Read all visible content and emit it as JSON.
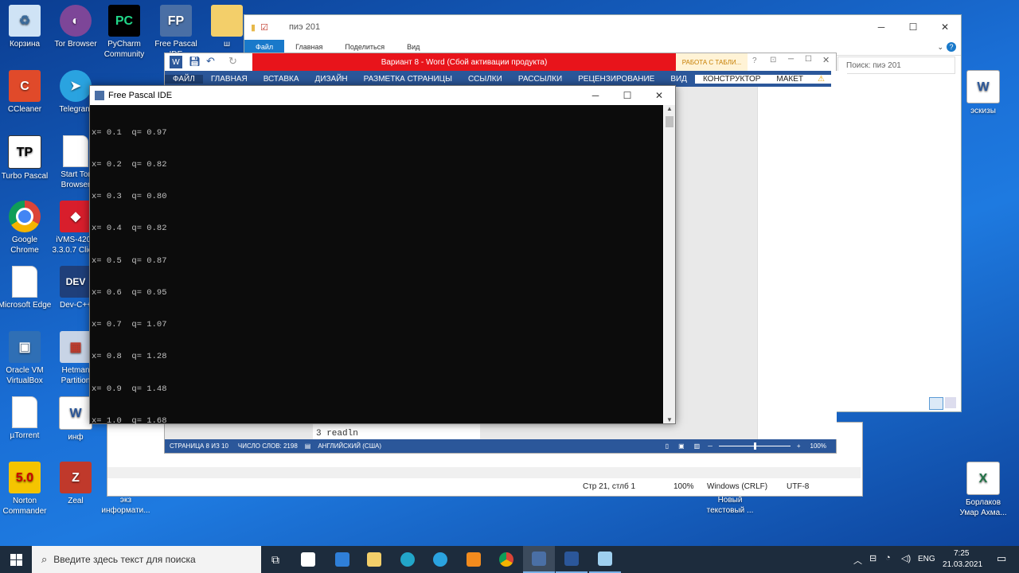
{
  "desktop": {
    "icons_left": [
      {
        "label": "Корзина"
      },
      {
        "label": "CCleaner"
      },
      {
        "label": "Turbo Pascal"
      },
      {
        "label": "Google Chrome"
      },
      {
        "label": "Microsoft Edge"
      },
      {
        "label": "Oracle VM VirtualBox"
      },
      {
        "label": "µTorrent"
      },
      {
        "label": "Norton Commander"
      }
    ],
    "icons_col2": [
      {
        "label": "Tor Browser"
      },
      {
        "label": "Telegram"
      },
      {
        "label": "Start Tor Browser"
      },
      {
        "label": "iVMS-4200 3.3.0.7 Client"
      },
      {
        "label": "Dev-C++"
      },
      {
        "label": "Hetman Partition"
      },
      {
        "label": "инф"
      },
      {
        "label": "Zeal"
      }
    ],
    "icons_top": [
      {
        "label": "PyCharm Community"
      },
      {
        "label": "Free Pascal IDE"
      },
      {
        "label": "ш"
      }
    ],
    "icons_right": [
      {
        "label": "эскизы"
      },
      {
        "label": "Борлаков Умар Ахма..."
      }
    ],
    "icons_bottom": [
      {
        "label": "экз информати..."
      },
      {
        "label": "Новый текстовый ..."
      }
    ]
  },
  "explorer": {
    "title": "пиэ 201",
    "tabs": [
      "Файл",
      "Главная",
      "Поделиться",
      "Вид"
    ],
    "search_placeholder": "Поиск: пиэ 201"
  },
  "notepad": {
    "status": [
      "Стр 21, стлб 1",
      "100%",
      "Windows (CRLF)",
      "UTF-8"
    ]
  },
  "word": {
    "title": "Вариант 8 - Word (Сбой активации продукта)",
    "table_tools": "РАБОТА С ТАБЛИ...",
    "menu": [
      "ФАЙЛ",
      "ГЛАВНАЯ",
      "ВСТАВКА",
      "ДИЗАЙН",
      "РАЗМЕТКА СТРАНИЦЫ",
      "ССЫЛКИ",
      "РАССЫЛКИ",
      "РЕЦЕНЗИРОВАНИЕ",
      "ВИД",
      "КОНСТРУКТОР",
      "МАКЕТ"
    ],
    "doc_lines": [
      "3 readln"
    ],
    "status": {
      "page": "СТРАНИЦА 8 ИЗ 10",
      "words": "ЧИСЛО СЛОВ: 2198",
      "lang": "АНГЛИЙСКИЙ (США)",
      "zoom": "100%"
    }
  },
  "fpc": {
    "title": "Free Pascal IDE",
    "output": [
      "x= 0.1  q= 0.97",
      "x= 0.2  q= 0.82",
      "x= 0.3  q= 0.80",
      "x= 0.4  q= 0.82",
      "x= 0.5  q= 0.87",
      "x= 0.6  q= 0.95",
      "x= 0.7  q= 1.07",
      "x= 0.8  q= 1.28",
      "x= 0.9  q= 1.48",
      "x= 1.0  q= 1.68"
    ]
  },
  "taskbar": {
    "search_placeholder": "Введите здесь текст для поиска",
    "lang": "ENG",
    "time": "7:25",
    "date": "21.03.2021"
  }
}
